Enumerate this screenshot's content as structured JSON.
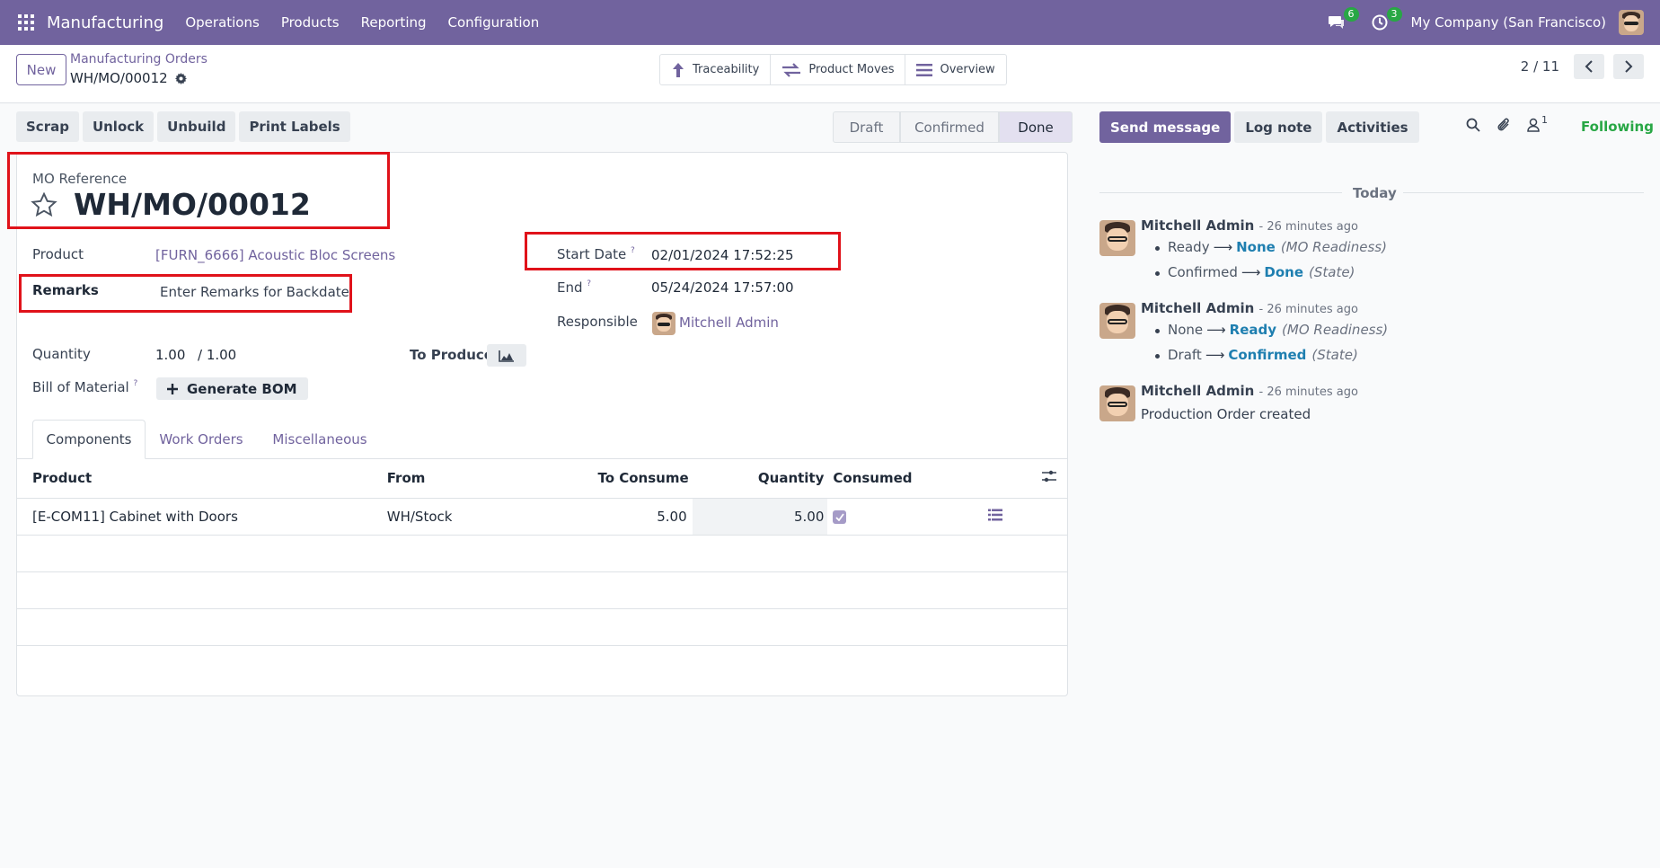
{
  "navbar": {
    "app_name": "Manufacturing",
    "menu": [
      "Operations",
      "Products",
      "Reporting",
      "Configuration"
    ],
    "messages_count": "6",
    "activities_count": "3",
    "company": "My Company (San Francisco)"
  },
  "control": {
    "new_label": "New",
    "breadcrumb_parent": "Manufacturing Orders",
    "breadcrumb_current": "WH/MO/00012",
    "smart_buttons": [
      "Traceability",
      "Product Moves",
      "Overview"
    ],
    "pager_value": "2 / 11"
  },
  "actions": [
    "Scrap",
    "Unlock",
    "Unbuild",
    "Print Labels"
  ],
  "statusbar": [
    "Draft",
    "Confirmed",
    "Done"
  ],
  "form": {
    "ref_label": "MO Reference",
    "ref_value": "WH/MO/00012",
    "product_label": "Product",
    "product_value": "[FURN_6666] Acoustic Bloc Screens",
    "remarks_label": "Remarks",
    "remarks_placeholder": "Enter Remarks for Backdate",
    "quantity_label": "Quantity",
    "quantity_value": "1.00",
    "quantity_total": "/ 1.00",
    "to_produce_label": "To Produce",
    "bom_label": "Bill of Material",
    "bom_help": "?",
    "bom_button": "Generate BOM",
    "start_date_label": "Start Date",
    "start_date_help": "?",
    "start_date_value": "02/01/2024 17:52:25",
    "end_label": "End",
    "end_help": "?",
    "end_value": "05/24/2024 17:57:00",
    "responsible_label": "Responsible",
    "responsible_value": "Mitchell Admin"
  },
  "tabs": [
    "Components",
    "Work Orders",
    "Miscellaneous"
  ],
  "components": {
    "headers": [
      "Product",
      "From",
      "To Consume",
      "Quantity",
      "Consumed"
    ],
    "rows": [
      {
        "product": "[E-COM11] Cabinet with Doors",
        "from": "WH/Stock",
        "to_consume": "5.00",
        "quantity": "5.00",
        "consumed": true
      }
    ]
  },
  "chatter": {
    "send_message": "Send message",
    "log_note": "Log note",
    "activities": "Activities",
    "followers_count": "1",
    "following": "Following",
    "date_separator": "Today",
    "messages": [
      {
        "author": "Mitchell Admin",
        "time": "- 26 minutes ago",
        "changes": [
          {
            "old": "Ready",
            "new": "None",
            "field": "(MO Readiness)"
          },
          {
            "old": "Confirmed",
            "new": "Done",
            "field": "(State)"
          }
        ]
      },
      {
        "author": "Mitchell Admin",
        "time": "- 26 minutes ago",
        "changes": [
          {
            "old": "None",
            "new": "Ready",
            "field": "(MO Readiness)"
          },
          {
            "old": "Draft",
            "new": "Confirmed",
            "field": "(State)"
          }
        ]
      },
      {
        "author": "Mitchell Admin",
        "time": "- 26 minutes ago",
        "body": "Production Order created"
      }
    ]
  },
  "colors": {
    "brand": "#71639e",
    "highlight": "#e0121a",
    "link": "#1f7fb0",
    "following": "#28a745"
  }
}
